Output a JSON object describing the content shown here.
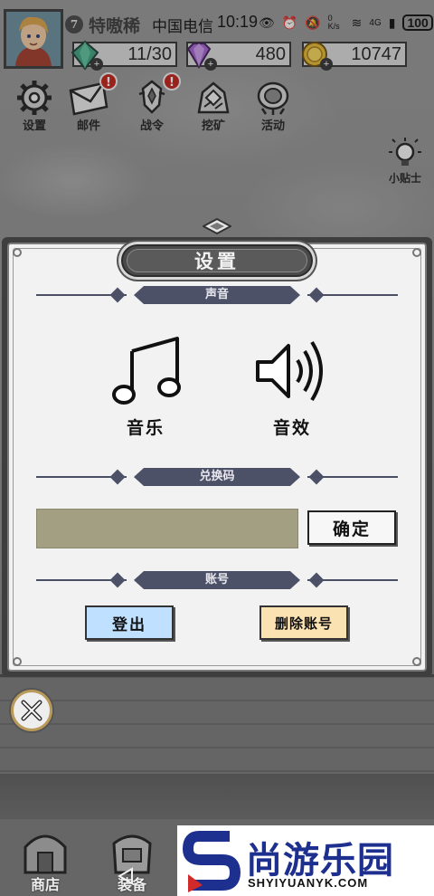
{
  "status_bar": {
    "carrier": "中国电信",
    "time": "10:19",
    "net_speed": "0 K/s",
    "network": "4G",
    "battery": "100"
  },
  "player": {
    "level": "7",
    "name": "特嗷稀"
  },
  "resources": [
    {
      "icon": "green-gem-icon",
      "value": "11/30"
    },
    {
      "icon": "purple-diamond-icon",
      "value": "480"
    },
    {
      "icon": "gold-coin-icon",
      "value": "10747"
    }
  ],
  "top_menu": [
    {
      "id": "settings",
      "icon": "gear-icon",
      "label": "设置",
      "badge": ""
    },
    {
      "id": "mail",
      "icon": "envelope-icon",
      "label": "邮件",
      "badge": "!"
    },
    {
      "id": "battle-order",
      "icon": "battle-order-icon",
      "label": "战令",
      "badge": "!"
    },
    {
      "id": "mining",
      "icon": "mining-icon",
      "label": "挖矿",
      "badge": ""
    },
    {
      "id": "events",
      "icon": "event-icon",
      "label": "活动",
      "badge": ""
    }
  ],
  "tips": {
    "label": "小贴士",
    "icon": "lightbulb-icon"
  },
  "dialog": {
    "title": "设置",
    "sections": {
      "sound": "声音",
      "redeem": "兑换码",
      "account": "账号"
    },
    "music_label": "音乐",
    "sfx_label": "音效",
    "redeem_placeholder": "",
    "confirm_label": "确定",
    "logout_label": "登出",
    "delete_account_label": "删除账号"
  },
  "bottom_nav": [
    {
      "label": "商店",
      "icon": "shop-icon"
    },
    {
      "label": "装备",
      "icon": "backpack-icon"
    }
  ],
  "watermark": {
    "brand": "尚游乐园",
    "url": "SHYIYUANYK.COM"
  },
  "colors": {
    "dialog_bg": "#f2f2f2",
    "ribbon": "#4c5168",
    "redeem_input": "#a39f83",
    "logout_btn": "#bfe0ff",
    "delete_btn": "#fbe2b3",
    "badge_red": "#c0201a",
    "watermark_blue": "#1d2f8f"
  }
}
